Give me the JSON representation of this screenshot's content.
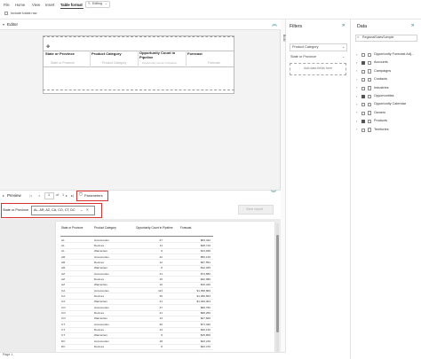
{
  "ribbon": {
    "tabs": [
      "File",
      "Home",
      "View",
      "Insert",
      "Table format"
    ],
    "editing_label": "Editing",
    "include_totals_label": "Include totals row"
  },
  "editor": {
    "title": "Editor",
    "headers": [
      "State or Province",
      "Product Category",
      "Opportunity Count in Pipeline",
      "Forecast"
    ],
    "placeholders": [
      "State or Province",
      "Product Category",
      "Opportunity Count in Pipeline",
      "Forecast"
    ]
  },
  "filters": {
    "title": "Filters",
    "product_category": "Product Category",
    "state_filter": "State or Province",
    "add_fields": "Add data fields here",
    "side_label": "Build"
  },
  "data": {
    "title": "Data",
    "search_value": "RegionalSalesSample",
    "items": [
      {
        "label": "Opportunity Forecast Adj...",
        "checked": false,
        "expanded": false
      },
      {
        "label": "Accounts",
        "checked": true,
        "expanded": false
      },
      {
        "label": "Campaigns",
        "checked": false,
        "expanded": false
      },
      {
        "label": "Contacts",
        "checked": false,
        "expanded": false
      },
      {
        "label": "Industries",
        "checked": false,
        "expanded": false
      },
      {
        "label": "Opportunities",
        "checked": true,
        "expanded": false
      },
      {
        "label": "Opportunity Calendar",
        "checked": false,
        "expanded": false
      },
      {
        "label": "Owners",
        "checked": false,
        "expanded": false
      },
      {
        "label": "Products",
        "checked": true,
        "expanded": false
      },
      {
        "label": "Territories",
        "checked": false,
        "expanded": false
      }
    ]
  },
  "preview": {
    "title": "Preview",
    "page_current": "1",
    "page_sep": "of",
    "page_total": "1",
    "parameters_label": "Parameters",
    "state_label": "State or Province",
    "state_value": "AL, AR, AZ, CA, CO, CT, DC",
    "view_report_label": "View report"
  },
  "report": {
    "headers": [
      "State or Province",
      "Product Category",
      "Opportunity Count in Pipeline",
      "Forecast"
    ],
    "rows": [
      [
        "AL",
        "Accessories",
        "27",
        "$63,442"
      ],
      [
        "AL",
        "Devices",
        "11",
        "$28,710"
      ],
      [
        "AL",
        "Warranties",
        "9",
        "$14,038"
      ],
      [
        "AR",
        "Accessories",
        "22",
        "$56,130"
      ],
      [
        "AR",
        "Devices",
        "12",
        "$37,551"
      ],
      [
        "AR",
        "Warranties",
        "8",
        "$12,045"
      ],
      [
        "AZ",
        "Accessories",
        "31",
        "$74,580"
      ],
      [
        "AZ",
        "Devices",
        "15",
        "$42,980"
      ],
      [
        "AZ",
        "Warranties",
        "10",
        "$16,420"
      ],
      [
        "CA",
        "Accessories",
        "113",
        "$1,958,800"
      ],
      [
        "CA",
        "Devices",
        "45",
        "$1,286,564"
      ],
      [
        "CA",
        "Warranties",
        "41",
        "$1,029,404"
      ],
      [
        "CO",
        "Accessories",
        "37",
        "$99,750"
      ],
      [
        "CO",
        "Devices",
        "21",
        "$68,250"
      ],
      [
        "CO",
        "Warranties",
        "13",
        "$27,660"
      ],
      [
        "CT",
        "Accessories",
        "29",
        "$71,320"
      ],
      [
        "CT",
        "Devices",
        "14",
        "$40,130"
      ],
      [
        "CT",
        "Warranties",
        "9",
        "$15,806"
      ],
      [
        "DC",
        "Accessories",
        "18",
        "$43,210"
      ],
      [
        "DC",
        "Devices",
        "8",
        "$22,470"
      ],
      [
        "DC",
        "Warranties",
        "6",
        "$10,860"
      ],
      [
        "",
        "",
        "",
        "$5,829,153"
      ]
    ]
  },
  "status": {
    "page": "Page 1"
  },
  "colors": {
    "highlight": "#d9322f",
    "accent": "#444444"
  }
}
